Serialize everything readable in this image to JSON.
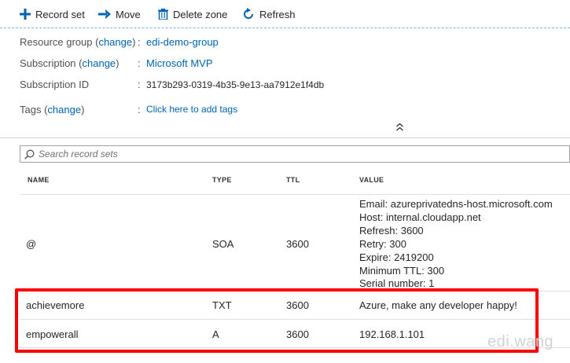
{
  "toolbar": {
    "record_set": "Record set",
    "move": "Move",
    "delete_zone": "Delete zone",
    "refresh": "Refresh"
  },
  "essentials": {
    "resource_group": {
      "label": "Resource group",
      "change": "change",
      "value": "edi-demo-group"
    },
    "subscription": {
      "label": "Subscription",
      "change": "change",
      "value": "Microsoft MVP"
    },
    "subscription_id": {
      "label": "Subscription ID",
      "value": "3173b293-0319-4b35-9e13-aa7912e1f4db"
    },
    "tags": {
      "label": "Tags",
      "change": "change",
      "value": "Click here to add tags"
    }
  },
  "search": {
    "placeholder": "Search record sets"
  },
  "table": {
    "headers": {
      "name": "NAME",
      "type": "TYPE",
      "ttl": "TTL",
      "value": "VALUE"
    },
    "rows": [
      {
        "name": "@",
        "type": "SOA",
        "ttl": "3600",
        "value_lines": [
          "Email: azureprivatedns-host.microsoft.com",
          "Host: internal.cloudapp.net",
          "Refresh: 3600",
          "Retry: 300",
          "Expire: 2419200",
          "Minimum TTL: 300",
          "Serial number: 1"
        ]
      },
      {
        "name": "achievemore",
        "type": "TXT",
        "ttl": "3600",
        "value": "Azure, make any developer happy!"
      },
      {
        "name": "empowerall",
        "type": "A",
        "ttl": "3600",
        "value": "192.168.1.101"
      }
    ]
  },
  "watermark": "edi.wang",
  "colors": {
    "accent": "#0063b1",
    "highlight": "#ff0000"
  }
}
